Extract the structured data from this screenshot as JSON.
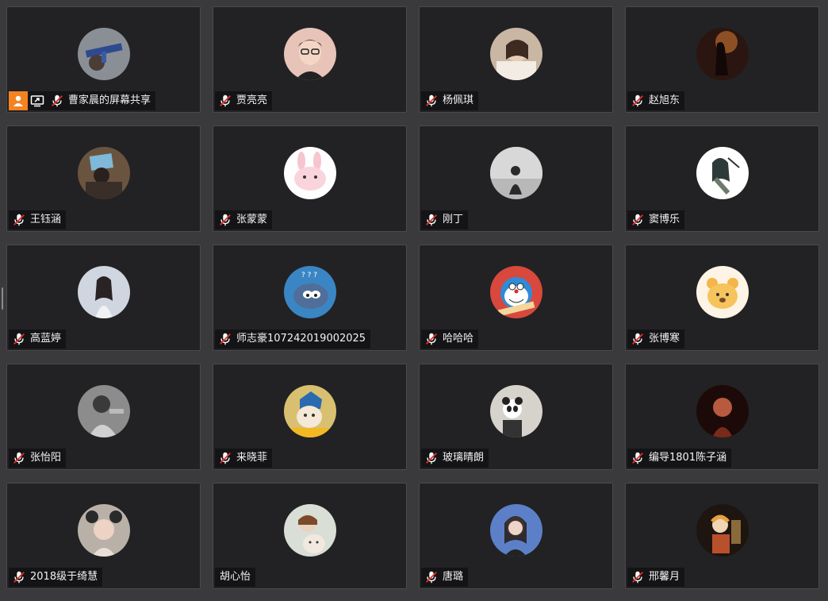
{
  "participants": [
    {
      "name": "曹家晨的屏幕共享",
      "muted": true,
      "host": true,
      "sharing": true,
      "avatar": "gun-photo-icon"
    },
    {
      "name": "贾亮亮",
      "muted": true,
      "avatar": "cartoon-man-icon"
    },
    {
      "name": "杨佩琪",
      "muted": true,
      "avatar": "girl-photo-icon"
    },
    {
      "name": "赵旭东",
      "muted": true,
      "avatar": "dark-figure-icon"
    },
    {
      "name": "王钰涵",
      "muted": true,
      "avatar": "group-photo-icon"
    },
    {
      "name": "张蒙蒙",
      "muted": true,
      "avatar": "pink-bunny-icon"
    },
    {
      "name": "刚丁",
      "muted": true,
      "avatar": "silhouette-icon"
    },
    {
      "name": "窦博乐",
      "muted": true,
      "avatar": "anime-girl-icon"
    },
    {
      "name": "高蓝婷",
      "muted": true,
      "avatar": "woman-photo-icon"
    },
    {
      "name": "师志豪107242019002025",
      "muted": true,
      "avatar": "tom-cat-icon"
    },
    {
      "name": "哈哈哈",
      "muted": true,
      "avatar": "doraemon-icon"
    },
    {
      "name": "张博寒",
      "muted": true,
      "avatar": "pooh-bear-icon"
    },
    {
      "name": "张怡阳",
      "muted": true,
      "avatar": "person-grey-icon"
    },
    {
      "name": "来晓菲",
      "muted": true,
      "avatar": "cartoon-cat-icon"
    },
    {
      "name": "玻璃晴朗",
      "muted": true,
      "avatar": "panda-photo-icon"
    },
    {
      "name": "编导1801陈子涵",
      "muted": true,
      "avatar": "red-portrait-icon"
    },
    {
      "name": "2018级于绮慧",
      "muted": true,
      "avatar": "mouse-ears-photo-icon"
    },
    {
      "name": "胡心怡",
      "muted": false,
      "avatar": "girl-cat-photo-icon"
    },
    {
      "name": "唐璐",
      "muted": true,
      "avatar": "girl-blue-photo-icon"
    },
    {
      "name": "邢馨月",
      "muted": true,
      "avatar": "anime-figure-icon"
    }
  ],
  "colors": {
    "host_badge": "#f58220",
    "tile_bg": "#222224",
    "page_bg": "#3a3a3c",
    "muted_mic": "#ffffff",
    "muted_slash": "#e0302c"
  }
}
